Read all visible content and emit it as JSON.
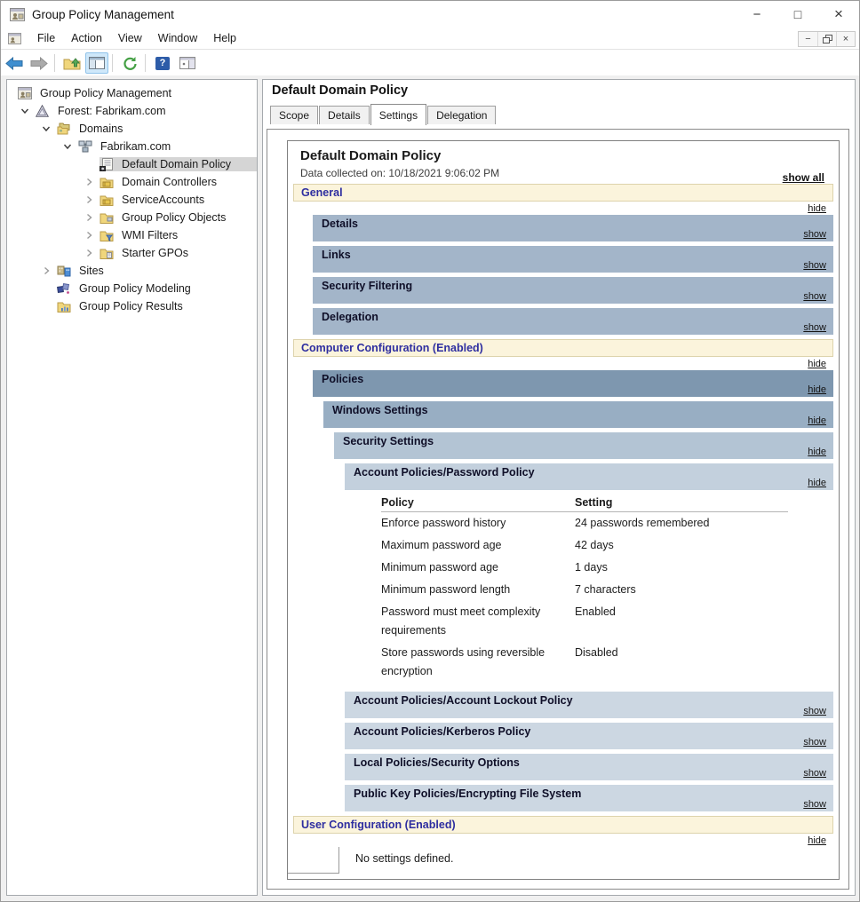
{
  "window": {
    "title": "Group Policy Management"
  },
  "icons": {
    "minimize": "−",
    "maximize": "□",
    "close": "×",
    "mdi_minimize": "−",
    "mdi_close": "×",
    "help": "?",
    "named": [
      "console-icon",
      "back-icon",
      "forward-icon",
      "up-folder-icon",
      "console-tree-toggle-icon",
      "refresh-icon",
      "help-icon",
      "action-pane-icon",
      "chevron-down-icon",
      "chevron-right-icon",
      "forest-icon",
      "domains-icon",
      "domain-icon",
      "gpo-icon",
      "ou-folder-icon",
      "folder-icon",
      "wmi-filter-icon",
      "starter-gpo-icon",
      "sites-icon",
      "modeling-icon",
      "results-icon"
    ]
  },
  "menu": {
    "items": [
      "File",
      "Action",
      "View",
      "Window",
      "Help"
    ]
  },
  "tree": {
    "items": [
      {
        "label": "Group Policy Management"
      },
      {
        "label": "Forest: Fabrikam.com"
      },
      {
        "label": "Domains"
      },
      {
        "label": "Fabrikam.com"
      },
      {
        "label": "Default Domain Policy",
        "selected": true
      },
      {
        "label": "Domain Controllers"
      },
      {
        "label": "ServiceAccounts"
      },
      {
        "label": "Group Policy Objects"
      },
      {
        "label": "WMI Filters"
      },
      {
        "label": "Starter GPOs"
      },
      {
        "label": "Sites"
      },
      {
        "label": "Group Policy Modeling"
      },
      {
        "label": "Group Policy Results"
      }
    ]
  },
  "content": {
    "title": "Default Domain Policy",
    "tabs": [
      "Scope",
      "Details",
      "Settings",
      "Delegation"
    ],
    "active_tab": "Settings"
  },
  "report": {
    "title": "Default Domain Policy",
    "collected_on": "Data collected on: 10/18/2021 9:06:02 PM",
    "show_all_label": "show all",
    "sections": {
      "general": {
        "label": "General",
        "link": "hide"
      },
      "details": {
        "label": "Details",
        "link": "show"
      },
      "links": {
        "label": "Links",
        "link": "show"
      },
      "security_filtering": {
        "label": "Security Filtering",
        "link": "show"
      },
      "delegation": {
        "label": "Delegation",
        "link": "show"
      },
      "computer_configuration": {
        "label": "Computer Configuration (Enabled)",
        "link": "hide"
      },
      "policies": {
        "label": "Policies",
        "link": "hide"
      },
      "windows_settings": {
        "label": "Windows Settings",
        "link": "hide"
      },
      "security_settings": {
        "label": "Security Settings",
        "link": "hide"
      },
      "password_policy": {
        "label": "Account Policies/Password Policy",
        "link": "hide"
      },
      "account_lockout": {
        "label": "Account Policies/Account Lockout Policy",
        "link": "show"
      },
      "kerberos": {
        "label": "Account Policies/Kerberos Policy",
        "link": "show"
      },
      "security_options": {
        "label": "Local Policies/Security Options",
        "link": "show"
      },
      "efs": {
        "label": "Public Key Policies/Encrypting File System",
        "link": "show"
      },
      "user_configuration": {
        "label": "User Configuration (Enabled)",
        "link": "hide"
      }
    },
    "password_table": {
      "headers": [
        "Policy",
        "Setting"
      ],
      "rows": [
        {
          "policy": "Enforce password history",
          "setting": "24 passwords remembered"
        },
        {
          "policy": "Maximum password age",
          "setting": "42 days"
        },
        {
          "policy": "Minimum password age",
          "setting": "1 days"
        },
        {
          "policy": "Minimum password length",
          "setting": "7 characters"
        },
        {
          "policy": "Password must meet complexity requirements",
          "setting": "Enabled"
        },
        {
          "policy": "Store passwords using reversible encryption",
          "setting": "Disabled"
        }
      ]
    },
    "user_config_empty": "No settings defined."
  },
  "colors": {
    "category_bar_bg": "#FBF4DC",
    "category_text": "#2E2EA0",
    "bar_general_children": "#A3B5C9",
    "bar_policies": "#7E97AF",
    "bar_windows_settings": "#98AEC3",
    "bar_security_settings": "#B3C4D4",
    "bar_password_policy": "#C3D0DD",
    "bar_light": "#CCD7E2",
    "toolbar_toggle_highlight": "#CFE8FA",
    "tree_selection": "#D5D5D5"
  }
}
